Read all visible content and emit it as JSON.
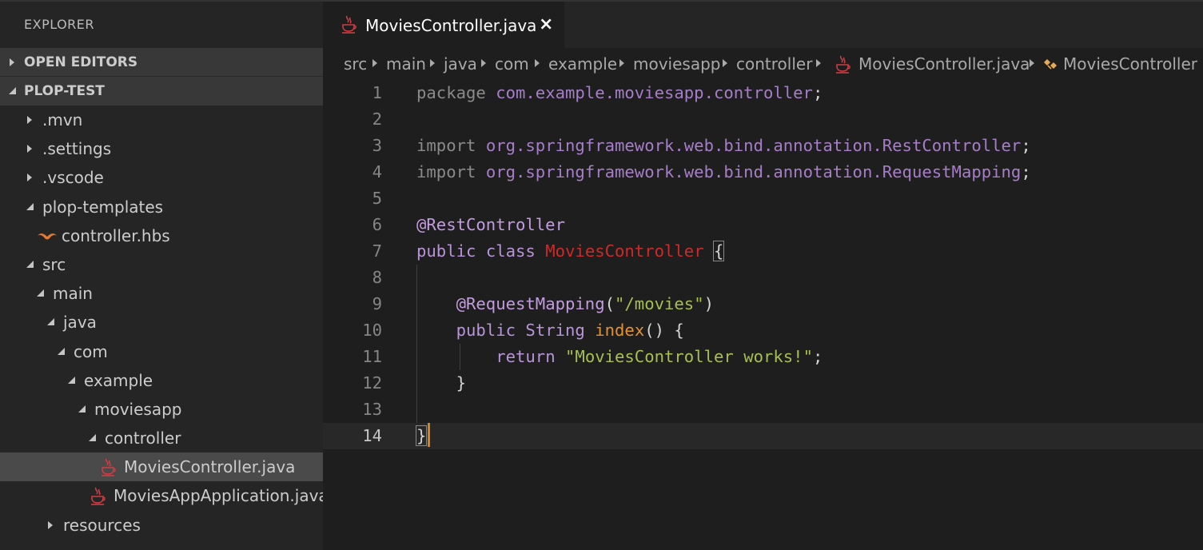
{
  "sidebar": {
    "title": "EXPLORER",
    "open_editors_label": "OPEN EDITORS",
    "project_label": "PLOP-TEST",
    "tree": [
      {
        "label": ".mvn",
        "depth": 0,
        "kind": "folder",
        "expanded": false
      },
      {
        "label": ".settings",
        "depth": 0,
        "kind": "folder",
        "expanded": false
      },
      {
        "label": ".vscode",
        "depth": 0,
        "kind": "folder",
        "expanded": false
      },
      {
        "label": "plop-templates",
        "depth": 0,
        "kind": "folder",
        "expanded": true
      },
      {
        "label": "controller.hbs",
        "depth": 1,
        "kind": "hbs"
      },
      {
        "label": "src",
        "depth": 0,
        "kind": "folder",
        "expanded": true
      },
      {
        "label": "main",
        "depth": 1,
        "kind": "folder",
        "expanded": true
      },
      {
        "label": "java",
        "depth": 2,
        "kind": "folder",
        "expanded": true
      },
      {
        "label": "com",
        "depth": 3,
        "kind": "folder",
        "expanded": true
      },
      {
        "label": "example",
        "depth": 4,
        "kind": "folder",
        "expanded": true
      },
      {
        "label": "moviesapp",
        "depth": 5,
        "kind": "folder",
        "expanded": true
      },
      {
        "label": "controller",
        "depth": 6,
        "kind": "folder",
        "expanded": true
      },
      {
        "label": "MoviesController.java",
        "depth": 7,
        "kind": "java",
        "selected": true
      },
      {
        "label": "MoviesAppApplication.java",
        "depth": 6,
        "kind": "java"
      },
      {
        "label": "resources",
        "depth": 2,
        "kind": "folder",
        "expanded": false
      }
    ]
  },
  "editor": {
    "tab": {
      "title": "MoviesController.java",
      "close_glyph": "×"
    },
    "breadcrumb": {
      "parts": [
        "src",
        "main",
        "java",
        "com",
        "example",
        "moviesapp",
        "controller"
      ],
      "file": "MoviesController.java",
      "symbol": "MoviesController"
    },
    "code": {
      "line_numbers": [
        "1",
        "2",
        "3",
        "4",
        "5",
        "6",
        "7",
        "8",
        "9",
        "10",
        "11",
        "12",
        "13",
        "14"
      ],
      "l1": {
        "kw": "package",
        "pkg": "com.example.moviesapp.controller",
        "end": ";"
      },
      "l3": {
        "kw": "import",
        "pkg": "org.springframework.web.bind.annotation.RestController",
        "end": ";"
      },
      "l4": {
        "kw": "import",
        "pkg": "org.springframework.web.bind.annotation.RequestMapping",
        "end": ";"
      },
      "l6": {
        "ann": "@RestController"
      },
      "l7": {
        "kw1": "public",
        "kw2": "class",
        "cls": "MoviesController",
        "brace": "{"
      },
      "l9": {
        "ann": "@RequestMapping",
        "open": "(",
        "str": "\"/movies\"",
        "close": ")"
      },
      "l10": {
        "kw": "public",
        "type": "String",
        "fn": "index",
        "rest": "() {"
      },
      "l11": {
        "kw": "return",
        "str": "\"MoviesController works!\"",
        "end": ";"
      },
      "l12": {
        "brace": "}"
      },
      "l14": {
        "brace": "}"
      }
    }
  },
  "colors": {
    "sidebar_bg": "#252526",
    "editor_bg": "#1e1e1e",
    "section_header_bg": "#383838",
    "selection_bg": "#4a4a4a",
    "java_icon": "#cc3e44",
    "hbs_icon": "#e37933",
    "cursor": "#d18616"
  },
  "icons": {
    "java": "java-cup-icon",
    "hbs": "handlebars-mustache-icon",
    "symbol": "class-symbol-icon",
    "close": "close-icon"
  }
}
